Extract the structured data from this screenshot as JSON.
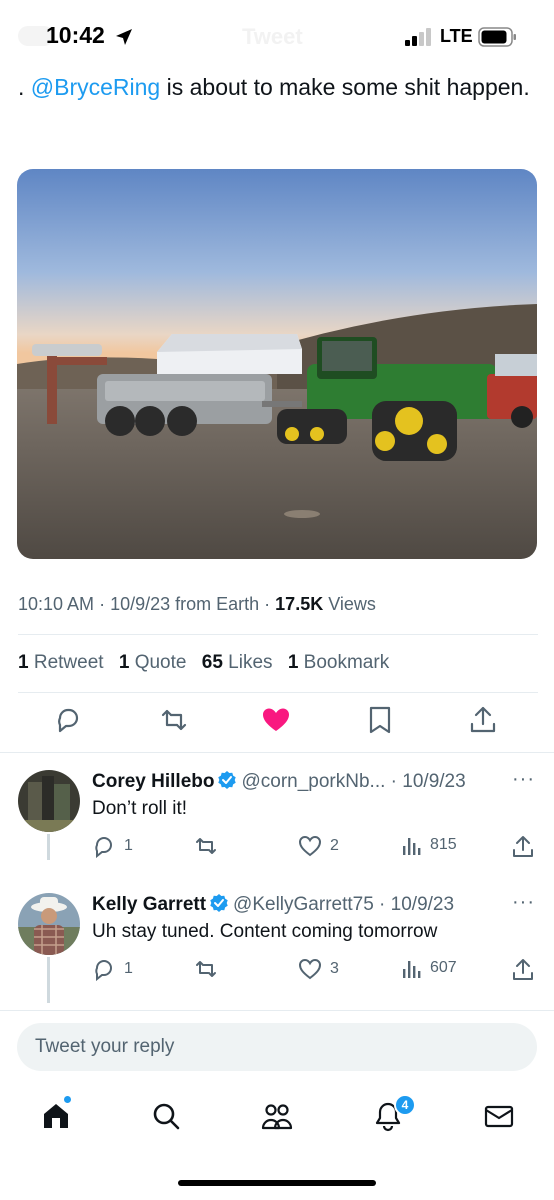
{
  "status_bar": {
    "time": "10:42",
    "network": "LTE",
    "header_title": "Tweet"
  },
  "tweet": {
    "text_prefix": ". ",
    "mention": "@BryceRing",
    "text_suffix": " is about to make some shit happen.",
    "media_alt": "photo",
    "time": "10:10 AM",
    "date": "10/9/23",
    "source": "from Earth",
    "views_count": "17.5K",
    "views_label": "Views",
    "stats": {
      "retweets_count": "1",
      "retweets_label": "Retweet",
      "quotes_count": "1",
      "quotes_label": "Quote",
      "likes_count": "65",
      "likes_label": "Likes",
      "bookmarks_count": "1",
      "bookmarks_label": "Bookmark"
    },
    "liked": true
  },
  "replies": [
    {
      "name": "Corey Hillebo",
      "handle": "@corn_porkNb...",
      "date": "10/9/23",
      "text": "Don’t roll it!",
      "reply_count": "1",
      "retweet_count": "",
      "like_count": "2",
      "view_count": "815"
    },
    {
      "name": "Kelly Garrett",
      "handle": "@KellyGarrett75",
      "date": "10/9/23",
      "text": "Uh stay tuned. Content coming tomorrow",
      "reply_count": "1",
      "retweet_count": "",
      "like_count": "3",
      "view_count": "607"
    }
  ],
  "compose": {
    "placeholder": "Tweet your reply"
  },
  "tabbar": {
    "notifications_badge": "4"
  },
  "colors": {
    "accent": "#1d9bf0",
    "like": "#f91880",
    "text": "#0f1419",
    "muted": "#536471"
  }
}
